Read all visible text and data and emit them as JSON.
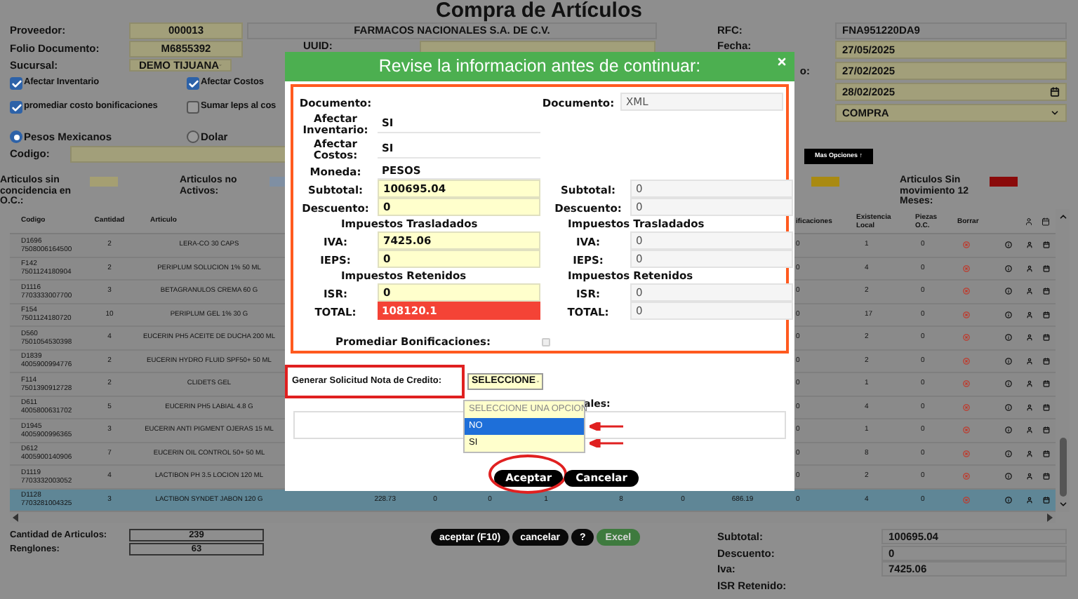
{
  "page_title": "Compra de Artículos",
  "form": {
    "proveedor": {
      "label": "Proveedor:",
      "code": "000013",
      "name": "FARMACOS NACIONALES S.A. DE C.V."
    },
    "folio": {
      "label": "Folio Documento:",
      "value": "M6855392"
    },
    "uuid": {
      "label": "UUID:"
    },
    "sucursal": {
      "label": "Sucursal:",
      "value": "DEMO TIJUANA"
    },
    "checkboxes": [
      {
        "label": "Afectar Inventario",
        "checked": true
      },
      {
        "label": "Afectar Costos",
        "checked": true
      },
      {
        "label": "promediar costo bonificaciones",
        "checked": true
      },
      {
        "label": "Sumar Ieps al cos",
        "checked": false
      }
    ],
    "currency": [
      {
        "label": "Pesos Mexicanos",
        "selected": true
      },
      {
        "label": "Dolar",
        "selected": false
      }
    ],
    "codigo": {
      "label": "Codigo:"
    },
    "rfc": {
      "label": "RFC:",
      "value": "FNA951220DA9"
    },
    "fecha": {
      "label": "Fecha:",
      "value": "27/05/2025"
    },
    "fecha_2": {
      "label": "o:",
      "value": "27/02/2025"
    },
    "fecha_3": {
      "value": "28/02/2025"
    },
    "tipo": {
      "value": "COMPRA"
    },
    "more_button": "Mas Opciones ↑"
  },
  "legend": [
    {
      "label": "Articulos sin concidencia en O.C.:",
      "color": "#a59f72"
    },
    {
      "label": "Articulos no Activos:",
      "color": "#7f8fa3"
    },
    {
      "color": "#a98a12"
    },
    {
      "label": "Articulos Sin movimiento 12 Meses:",
      "color": "#8a0a0a"
    }
  ],
  "table": {
    "columns": [
      "Codigo",
      "Cantidad",
      "Articulo",
      "ificaciones",
      "Existencia Local",
      "Piezas O.C.",
      "Borrar"
    ],
    "rows": [
      {
        "code": "D1696",
        "barcode": "7508006164500",
        "qty": "2",
        "article": "LERA-CO 30 CAPS",
        "bonif": "0",
        "existencia": "1",
        "piezas": "0",
        "selected": false
      },
      {
        "code": "F142",
        "barcode": "7501124180904",
        "qty": "2",
        "article": "PERIPLUM SOLUCION 1% 50 ML",
        "bonif": "0",
        "existencia": "4",
        "piezas": "0",
        "selected": false
      },
      {
        "code": "D1116",
        "barcode": "7703333007700",
        "qty": "3",
        "article": "BETAGRANULOS CREMA 60 G",
        "bonif": "0",
        "existencia": "2",
        "piezas": "0",
        "selected": false
      },
      {
        "code": "F154",
        "barcode": "7501124180720",
        "qty": "10",
        "article": "PERIPLUM GEL 1% 30 G",
        "bonif": "0",
        "existencia": "17",
        "piezas": "0",
        "selected": false
      },
      {
        "code": "D560",
        "barcode": "7501054530398",
        "qty": "4",
        "article": "EUCERIN PH5 ACEITE DE DUCHA 200 ML",
        "bonif": "0",
        "existencia": "2",
        "piezas": "0",
        "selected": false
      },
      {
        "code": "D1839",
        "barcode": "4005900994776",
        "qty": "2",
        "article": "EUCERIN HYDRO FLUID SPF50+ 50 ML",
        "bonif": "0",
        "existencia": "2",
        "piezas": "0",
        "selected": false
      },
      {
        "code": "F114",
        "barcode": "7501390912728",
        "qty": "2",
        "article": "CLIDETS GEL",
        "bonif": "0",
        "existencia": "1",
        "piezas": "0",
        "selected": false
      },
      {
        "code": "D611",
        "barcode": "4005800631702",
        "qty": "5",
        "article": "EUCERIN PH5 LABIAL 4.8 G",
        "bonif": "0",
        "existencia": "4",
        "piezas": "0",
        "selected": false
      },
      {
        "code": "D1945",
        "barcode": "4005900996365",
        "qty": "3",
        "article": "EUCERIN ANTI PIGMENT OJERAS 15 ML",
        "bonif": "0",
        "existencia": "1",
        "piezas": "0",
        "selected": false
      },
      {
        "code": "D612",
        "barcode": "4005900140906",
        "qty": "7",
        "article": "EUCERIN OIL CONTROL 50+ 50 ML",
        "bonif": "0",
        "existencia": "8",
        "piezas": "0",
        "selected": false
      },
      {
        "code": "D1119",
        "barcode": "7703332003052",
        "qty": "4",
        "article": "LACTIBON PH 3.5 LOCION 120 ML",
        "bonif": "0",
        "existencia": "2",
        "piezas": "0",
        "selected": false
      },
      {
        "code": "D1128",
        "barcode": "7703281004325",
        "qty": "3",
        "article": "LACTIBON SYNDET JABON 120 G",
        "middle": [
          "228.73",
          "0",
          "0",
          "1",
          "8",
          "0",
          "686.19"
        ],
        "bonif": "0",
        "existencia": "4",
        "piezas": "0",
        "selected": true
      }
    ]
  },
  "summary": [
    {
      "label": "Cantidad de Articulos:",
      "value": "239"
    },
    {
      "label": "Renglones:",
      "value": "63"
    }
  ],
  "actions": [
    {
      "label": "aceptar (F10)",
      "kind": "dark"
    },
    {
      "label": "cancelar",
      "kind": "dark"
    },
    {
      "label": "?",
      "kind": "dark"
    },
    {
      "label": "Excel",
      "kind": "excel"
    }
  ],
  "totals": [
    {
      "label": "Subtotal:",
      "value": "100695.04"
    },
    {
      "label": "Descuento:",
      "value": "0"
    },
    {
      "label": "Iva:",
      "value": "7425.06"
    },
    {
      "label": "ISR Retenido:"
    }
  ],
  "dialog": {
    "title": "Revise la informacion antes de continuar:",
    "rows": [
      {
        "left": {
          "kind": "label",
          "label": "Documento:"
        },
        "right": {
          "kind": "readonly",
          "label": "Documento:",
          "value": "XML"
        }
      },
      {
        "left": {
          "kind": "plain",
          "label": "Afectar Inventario:",
          "value": "SI"
        }
      },
      {
        "left": {
          "kind": "plain",
          "label": "Afectar Costos:",
          "value": "SI"
        }
      },
      {
        "left": {
          "kind": "plain",
          "label": "Moneda:",
          "value": "PESOS"
        }
      },
      {
        "left": {
          "kind": "input",
          "label": "Subtotal:",
          "value": "100695.04"
        },
        "right": {
          "kind": "readonly",
          "label": "Subtotal:",
          "value": "0"
        }
      },
      {
        "left": {
          "kind": "input",
          "label": "Descuento:",
          "value": "0"
        },
        "right": {
          "kind": "readonly",
          "label": "Descuento:",
          "value": "0"
        }
      },
      {
        "left": {
          "kind": "heading",
          "label": "Impuestos Trasladados"
        },
        "right": {
          "kind": "heading",
          "label": "Impuestos Trasladados"
        }
      },
      {
        "left": {
          "kind": "input",
          "label": "IVA:",
          "value": "7425.06"
        },
        "right": {
          "kind": "readonly",
          "label": "IVA:",
          "value": "0"
        }
      },
      {
        "left": {
          "kind": "input",
          "label": "IEPS:",
          "value": "0"
        },
        "right": {
          "kind": "readonly",
          "label": "IEPS:",
          "value": "0"
        }
      },
      {
        "left": {
          "kind": "heading",
          "label": "Impuestos Retenidos"
        },
        "right": {
          "kind": "heading",
          "label": "Impuestos Retenidos"
        }
      },
      {
        "left": {
          "kind": "input",
          "label": "ISR:",
          "value": "0"
        },
        "right": {
          "kind": "readonly",
          "label": "ISR:",
          "value": "0"
        }
      },
      {
        "left": {
          "kind": "total",
          "label": "TOTAL:",
          "value": "108120.1"
        },
        "right": {
          "kind": "readonly",
          "label": "TOTAL:",
          "value": "0"
        }
      }
    ],
    "promediar": {
      "label": "Promediar Bonificaciones:",
      "checked": false,
      "disabled": true
    },
    "nota_credito": {
      "label": "Generar Solicitud Nota de Credito:",
      "highlighted": true,
      "value": "SELECCIONE",
      "expanded": true,
      "options": [
        {
          "label": "SELECCIONE UNA OPCION",
          "selected": false,
          "disabled": true,
          "marked": false
        },
        {
          "label": "NO",
          "selected": true,
          "disabled": false,
          "marked": true
        },
        {
          "label": "SI",
          "selected": false,
          "disabled": false,
          "marked": true
        }
      ]
    },
    "observaciones": {
      "label": "ales:"
    },
    "buttons": [
      {
        "label": "Aceptar",
        "highlighted": true
      },
      {
        "label": "Cancelar",
        "highlighted": false
      }
    ]
  }
}
